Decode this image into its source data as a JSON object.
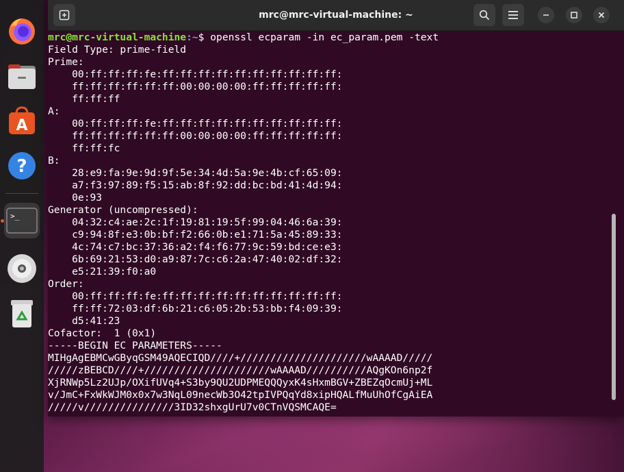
{
  "window": {
    "title": "mrc@mrc-virtual-machine: ~"
  },
  "dock": {
    "items": [
      {
        "name": "firefox-icon"
      },
      {
        "name": "files-icon"
      },
      {
        "name": "software-icon"
      },
      {
        "name": "help-icon"
      },
      {
        "name": "terminal-icon"
      },
      {
        "name": "disc-icon"
      },
      {
        "name": "trash-icon"
      }
    ]
  },
  "terminal": {
    "prompt_user": "mrc@mrc-virtual-machine",
    "prompt_path": ":~",
    "prompt_symbol": "$ ",
    "command": "openssl ecparam -in ec_param.pem -text",
    "output": "Field Type: prime-field\nPrime:\n    00:ff:ff:ff:fe:ff:ff:ff:ff:ff:ff:ff:ff:ff:ff:\n    ff:ff:ff:ff:ff:ff:00:00:00:00:ff:ff:ff:ff:ff:\n    ff:ff:ff\nA:\n    00:ff:ff:ff:fe:ff:ff:ff:ff:ff:ff:ff:ff:ff:ff:\n    ff:ff:ff:ff:ff:ff:00:00:00:00:ff:ff:ff:ff:ff:\n    ff:ff:fc\nB:\n    28:e9:fa:9e:9d:9f:5e:34:4d:5a:9e:4b:cf:65:09:\n    a7:f3:97:89:f5:15:ab:8f:92:dd:bc:bd:41:4d:94:\n    0e:93\nGenerator (uncompressed):\n    04:32:c4:ae:2c:1f:19:81:19:5f:99:04:46:6a:39:\n    c9:94:8f:e3:0b:bf:f2:66:0b:e1:71:5a:45:89:33:\n    4c:74:c7:bc:37:36:a2:f4:f6:77:9c:59:bd:ce:e3:\n    6b:69:21:53:d0:a9:87:7c:c6:2a:47:40:02:df:32:\n    e5:21:39:f0:a0\nOrder:\n    00:ff:ff:ff:fe:ff:ff:ff:ff:ff:ff:ff:ff:ff:ff:\n    ff:ff:72:03:df:6b:21:c6:05:2b:53:bb:f4:09:39:\n    d5:41:23\nCofactor:  1 (0x1)\n-----BEGIN EC PARAMETERS-----\nMIHgAgEBMCwGByqGSM49AQECIQD////+/////////////////////wAAAAD/////\n/////zBEBCD////+/////////////////////wAAAAD//////////AQgKOn6np2f\nXjRNWp5Lz2UJp/OXifUVq4+S3by9QU2UDPMEQQQyxK4sHxmBGV+ZBEZqOcmUj+ML\nv/JmC+FxWkWJM0x0x7w3NqL09necWb3O42tpIVPQqYd8xipHQALfMuUhOfCgAiEA\n/////v///////////////3ID32shxgUrU7v0CTnVQSMCAQE="
  }
}
